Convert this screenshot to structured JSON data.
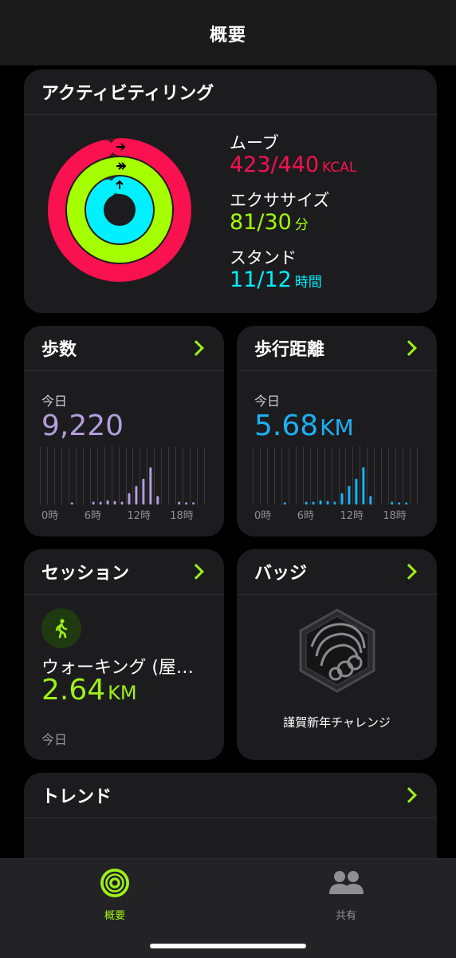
{
  "header": {
    "title": "概要"
  },
  "activity": {
    "title": "アクティビティリング",
    "move": {
      "label": "ムーブ",
      "value": "423/440",
      "unit": "KCAL",
      "color": "#fa114f",
      "fraction": 0.961
    },
    "exercise": {
      "label": "エクササイズ",
      "value": "81/30",
      "unit": "分",
      "color": "#a6ff00",
      "fraction": 2.7
    },
    "stand": {
      "label": "スタンド",
      "value": "11/12",
      "unit": "時間",
      "color": "#00f0ff",
      "fraction": 0.917
    }
  },
  "steps": {
    "title": "歩数",
    "period": "今日",
    "value": "9,220",
    "color": "#b39ddb",
    "axis_labels": [
      "0時",
      "6時",
      "12時",
      "18時"
    ],
    "hourly": [
      0,
      0,
      0,
      0,
      0.03,
      0,
      0,
      0.04,
      0.04,
      0.06,
      0.05,
      0.04,
      0.16,
      0.26,
      0.36,
      0.52,
      0.12,
      0,
      0,
      0.04,
      0.03,
      0.03,
      0,
      0
    ]
  },
  "distance": {
    "title": "歩行距離",
    "period": "今日",
    "value": "5.68",
    "unit": "KM",
    "color": "#1cb0f6",
    "axis_labels": [
      "0時",
      "6時",
      "12時",
      "18時"
    ],
    "hourly": [
      0,
      0,
      0,
      0,
      0.03,
      0,
      0,
      0.04,
      0.04,
      0.06,
      0.05,
      0.04,
      0.16,
      0.26,
      0.36,
      0.52,
      0.12,
      0,
      0,
      0.04,
      0.03,
      0.03,
      0,
      0
    ]
  },
  "session": {
    "title": "セッション",
    "icon": "walking-icon",
    "name": "ウォーキング (屋…",
    "value": "2.64",
    "unit": "KM",
    "day": "今日"
  },
  "badge": {
    "title": "バッジ",
    "icon": "new-year-badge-icon",
    "label": "謹賀新年チャレンジ"
  },
  "trend": {
    "title": "トレンド"
  },
  "tabbar": {
    "summary_label": "概要",
    "share_label": "共有",
    "active_color": "#9ef01a",
    "inactive_color": "#8e8e93"
  }
}
